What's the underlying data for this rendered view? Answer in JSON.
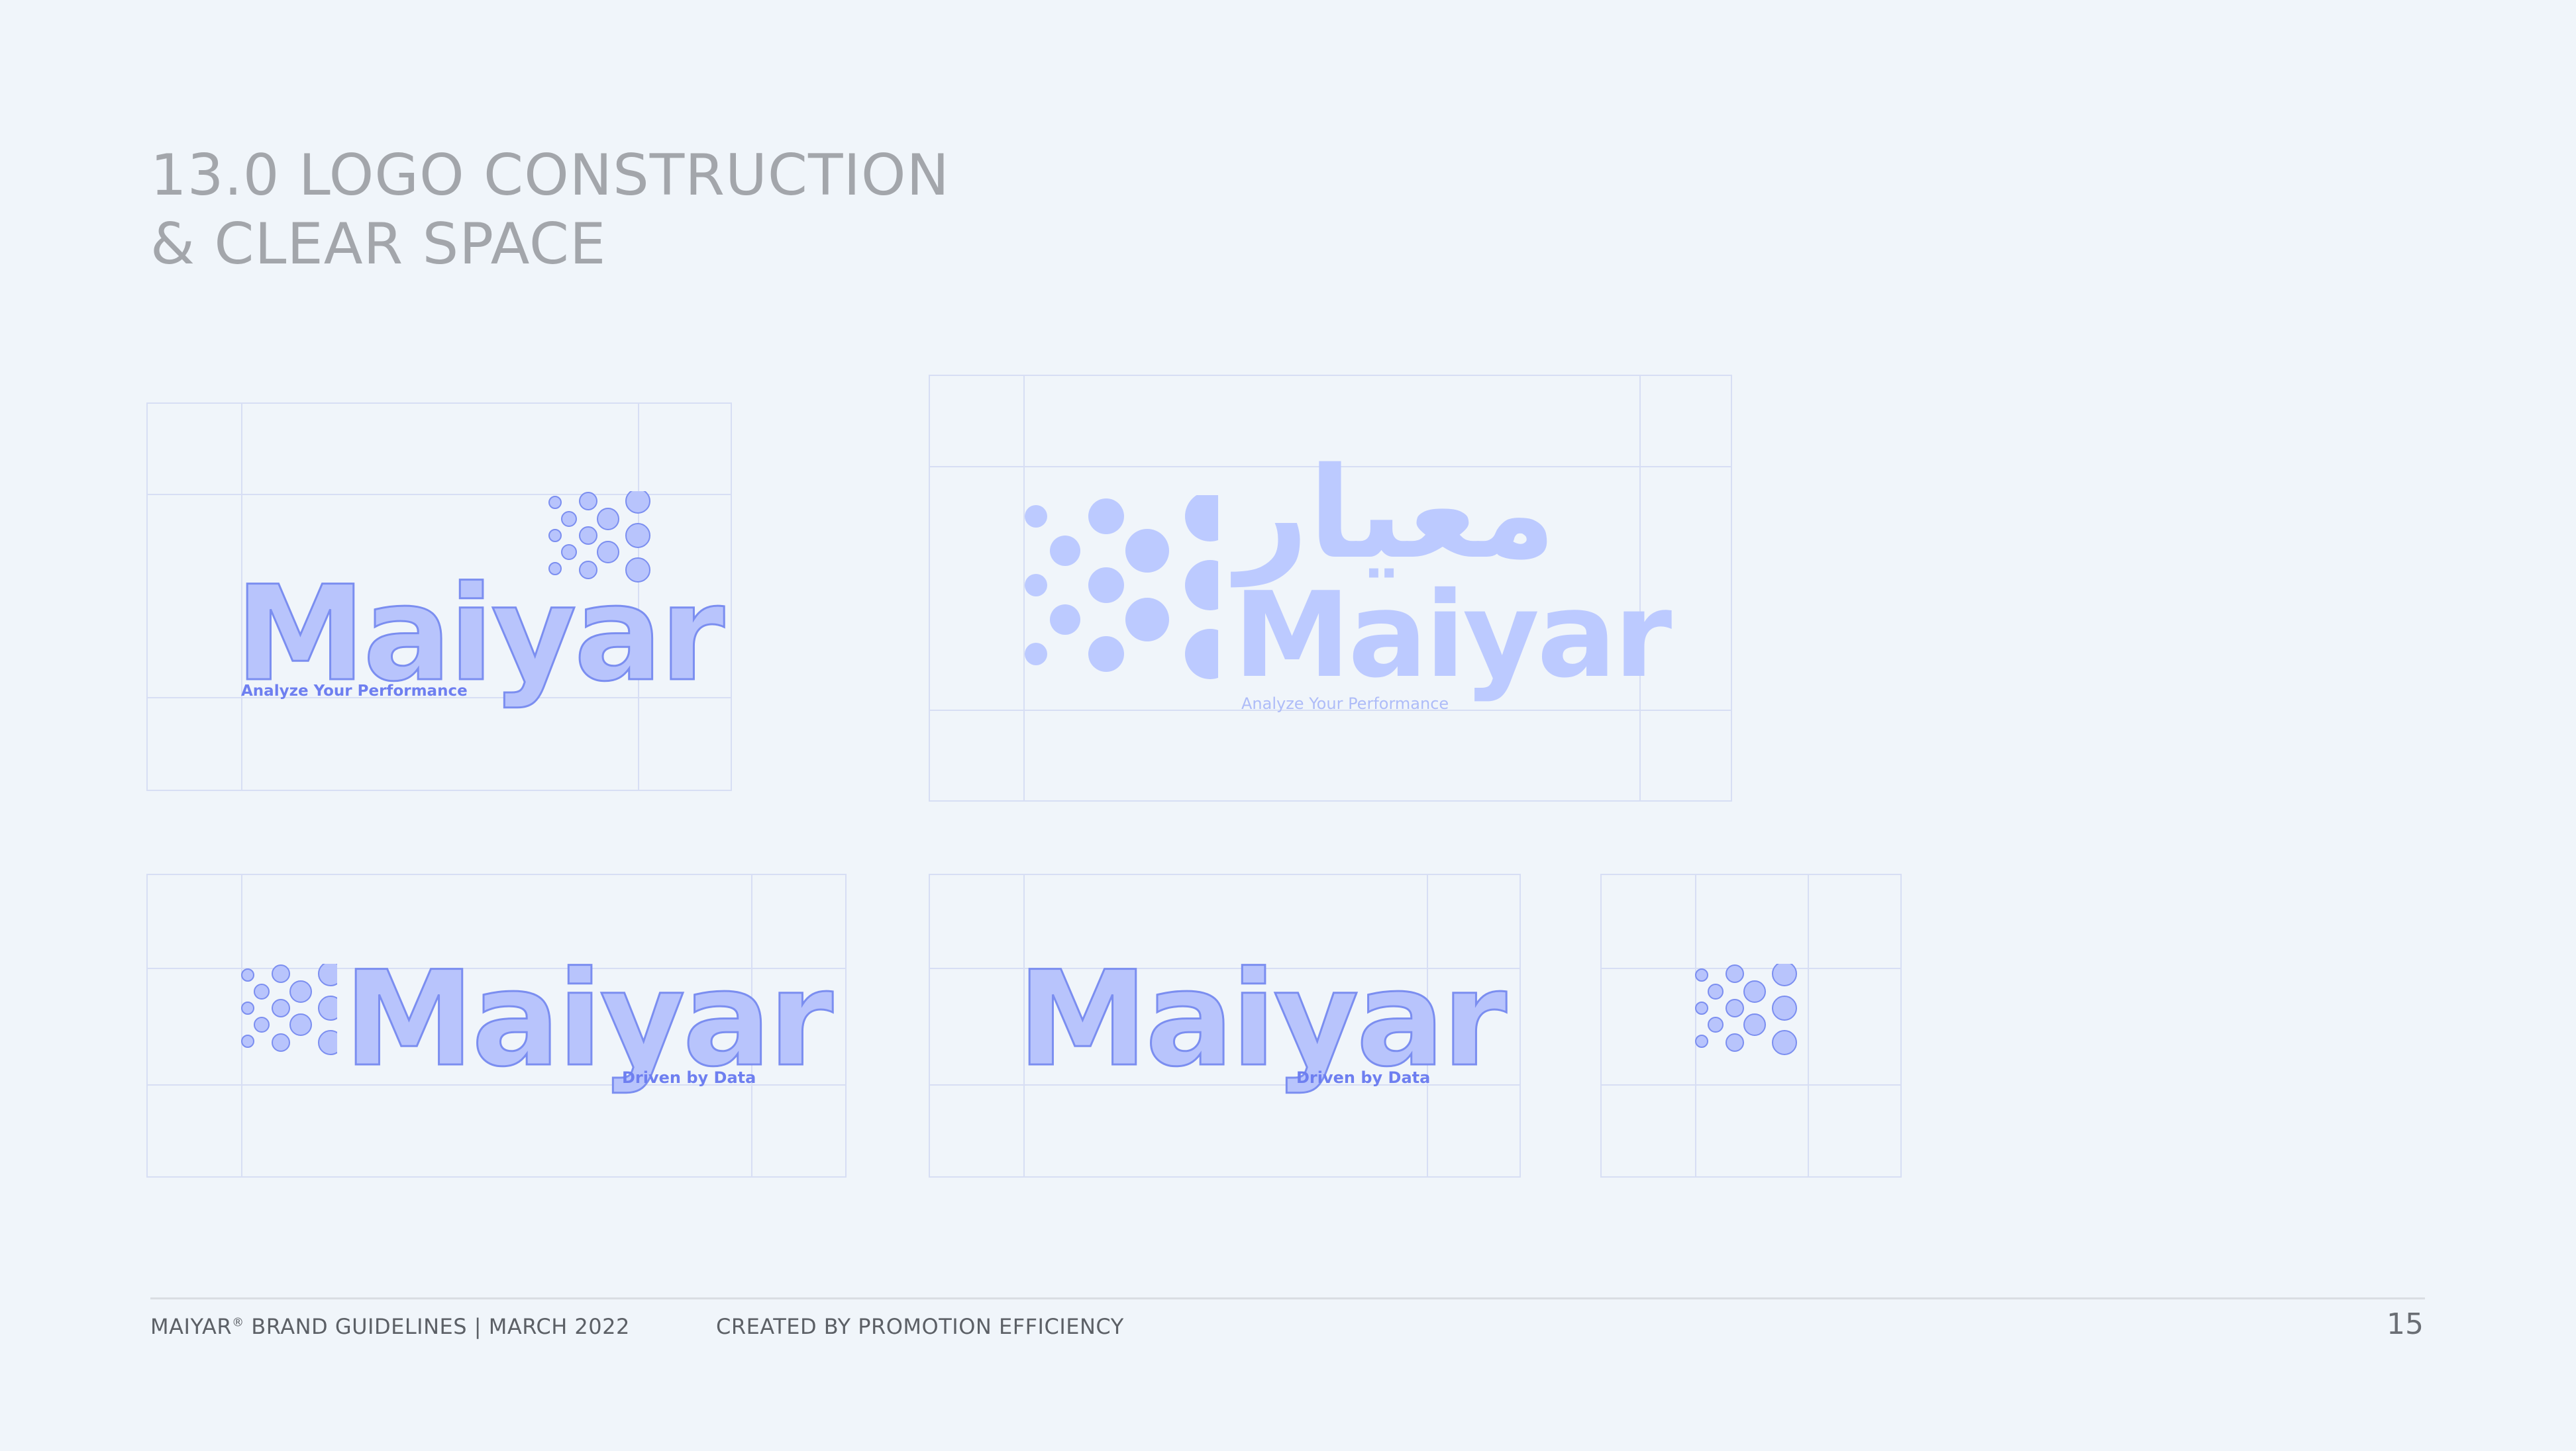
{
  "heading": {
    "line1": "13.0 LOGO CONSTRUCTION",
    "line2": "& CLEAR SPACE"
  },
  "logo": {
    "wordmark": "Maiyar",
    "arabic_wordmark": "معيار",
    "tagline_analyze": "Analyze Your Performance",
    "tagline_driven": "Driven by Data"
  },
  "colors": {
    "background": "#f0f5fa",
    "grid_line": "#d7def4",
    "logo_fill": "#b8c4fc",
    "logo_outline": "#7b8ef0",
    "tagline": "#6e7ff0",
    "heading": "#a3a6ab"
  },
  "footer": {
    "brand": "MAIYAR",
    "registered_mark": "®",
    "guidelines": "BRAND GUIDELINES | MARCH 2022",
    "credit": "CREATED BY PROMOTION EFFICIENCY",
    "page_number": "15"
  }
}
